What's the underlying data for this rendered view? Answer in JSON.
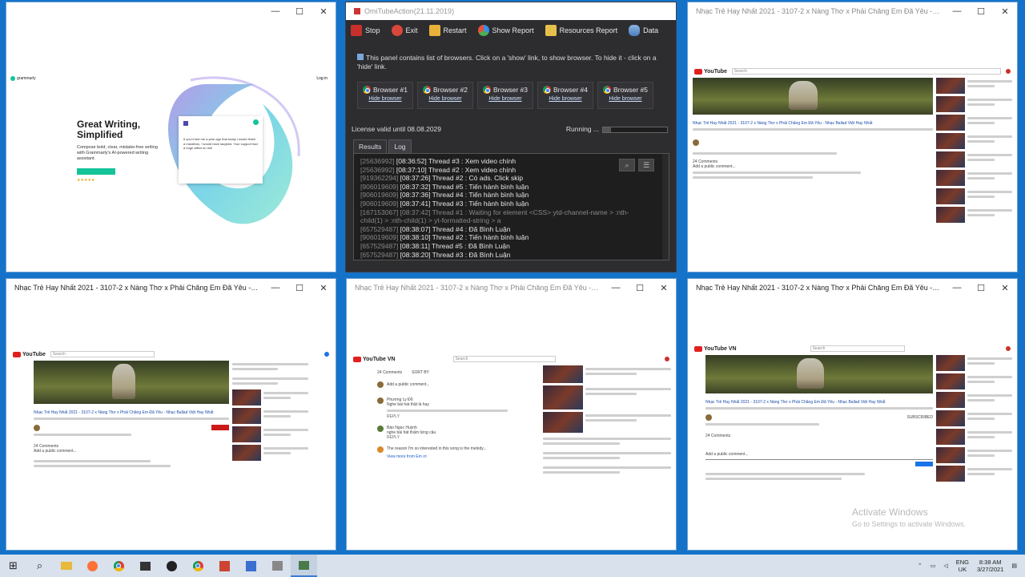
{
  "windows": {
    "top_left": {
      "title": ""
    },
    "browser_title": "Nhạc Trẻ Hay Nhất 2021 - 3107-2 x Nàng Thơ x Phải Chăng Em Đã Yêu - Nhạc Balla...",
    "controls": {
      "min": "—",
      "max": "☐",
      "close": "✕"
    }
  },
  "grammarly": {
    "brand": "grammarly",
    "login": "Log in",
    "headline1": "Great Writing,",
    "headline2": "Simplified",
    "body": "Compose bold, clear, mistake-free writing with Grammarly's AI-powered writing assistant.",
    "stars": "★★★★★",
    "popup_text": "If you'd told me a year ago that today I would finish a marathon, I would have laughed. Your support had a huge affect on me!"
  },
  "panel": {
    "title": "OmiTubeAction(21.11.2019)",
    "toolbar": [
      "Stop",
      "Exit",
      "Restart",
      "Show Report",
      "Resources Report",
      "Data"
    ],
    "info": "This panel contains list of browsers. Click on a 'show' link, to show browser. To hide it - click on a 'hide' link.",
    "browsers": [
      "Browser #1",
      "Browser #2",
      "Browser #3",
      "Browser #4",
      "Browser #5"
    ],
    "hide_label": "Hide browser",
    "license": "License valid until 08.08.2029",
    "running": "Running ...",
    "progress": 0.12,
    "tabs": [
      "Results",
      "Log"
    ],
    "log": [
      {
        "id": "[25636992]",
        "text": "[08:36:52] Thread #3 : Xem video chính",
        "warn": false
      },
      {
        "id": "[25636992]",
        "text": "[08:37:10] Thread #2 : Xem video chính",
        "warn": false
      },
      {
        "id": "[919362294]",
        "text": "[08:37:26] Thread #2 : Có ads. Click skip",
        "warn": false
      },
      {
        "id": "[906019609]",
        "text": "[08:37:32] Thread #5 : Tiến hành bình luận",
        "warn": false
      },
      {
        "id": "[906019609]",
        "text": "[08:37:36] Thread #4 : Tiến hành bình luận",
        "warn": false
      },
      {
        "id": "[906019609]",
        "text": "[08:37:41] Thread #3 : Tiến hành bình luận",
        "warn": false
      },
      {
        "id": "[167153067]",
        "text": "[08:37:42] Thread #1 : Waiting for element <CSS> ytd-channel-name > :nth-",
        "warn": true
      },
      {
        "id": "",
        "text": "child(1) > :nth-child(1) > yt-formatted-string > a",
        "warn": true
      },
      {
        "id": "[657529487]",
        "text": "[08:38:07] Thread #4 : Đã Bình Luận",
        "warn": false
      },
      {
        "id": "[906019609]",
        "text": "[08:38:10] Thread #2 : Tiến hành bình luận",
        "warn": false
      },
      {
        "id": "[657529487]",
        "text": "[08:38:11] Thread #5 : Đã Bình Luận",
        "warn": false
      },
      {
        "id": "[657529487]",
        "text": "[08:38:20] Thread #3 : Đã Bình Luận",
        "warn": false
      }
    ]
  },
  "youtube": {
    "logo": "YouTube",
    "logo_vn": "YouTube VN",
    "search": "Search",
    "comments_count": "24 Comments",
    "sort": "SORT BY",
    "add_comment": "Add a public comment...",
    "reply": "REPLY",
    "video_title": "Nhạc Trẻ Hay Nhất 2021 - 3107-2 x Nàng Thơ x Phải Chăng Em Đã Yêu - Nhạc Ballad Việt Hay Nhất",
    "subscribe": "SUBSCRIBED",
    "comment1_author": "Phương Ly Đỗ",
    "comment1_text": "Nghe bài hát thật là hay",
    "comment2_author": "Bảo Ngọc Huỳnh",
    "comment2_text": "nghe bài hát thấm từng câu",
    "comment3_text": "The reason I'm so interested in this song is the melody...",
    "view_more": "View more from Em ơi"
  },
  "overlay": {
    "activate_title": "Activate Windows",
    "activate_sub": "Go to Settings to activate Windows."
  },
  "taskbar": {
    "start": "⊞",
    "lang1": "ENG",
    "lang2": "UK",
    "time": "8:38 AM",
    "date": "3/27/2021"
  }
}
